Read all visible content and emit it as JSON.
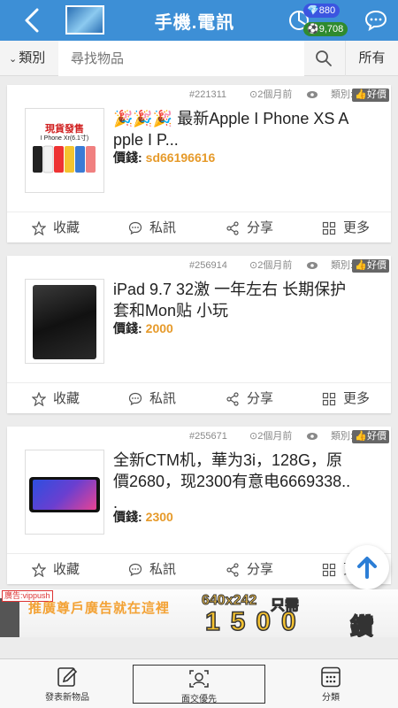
{
  "header": {
    "title": "手機.電訊",
    "diamonds": "880",
    "coins": "9,708"
  },
  "search": {
    "category_label": "類別",
    "placeholder": "尋找物品",
    "all_label": "所有"
  },
  "listings": [
    {
      "post_id": "#221311",
      "time": "2個月前",
      "category_label": "類別:",
      "tag": "好價",
      "title_line1": "🎉🎉🎉 最新Apple I Phone XS A",
      "title_line2": "pple I P...",
      "price_label": "價錢:",
      "price": "sd66196616",
      "image_text1": "現貨發售",
      "image_text2": "I Phone Xr(6.1寸)"
    },
    {
      "post_id": "#256914",
      "time": "2個月前",
      "category_label": "類別:",
      "tag": "好價",
      "title_line1": "iPad 9.7 32激 一年左右 长期保护",
      "title_line2": "套和Mon贴 小玩",
      "price_label": "價錢:",
      "price": "2000"
    },
    {
      "post_id": "#255671",
      "time": "2個月前",
      "category_label": "類別:",
      "tag": "好價",
      "title_line1": "全新CTM机，華为3i，128G，原",
      "title_line2": "價2680，现2300有意电6669338..",
      "title_line3": ".",
      "price_label": "價錢:",
      "price": "2300"
    }
  ],
  "actions": {
    "favorite": "收藏",
    "message": "私訊",
    "share": "分享",
    "more": "更多"
  },
  "ad": {
    "label": "廣告:vippush",
    "text": "推廣尊戶廣告就在這裡",
    "dimension": "640x242",
    "need": "只需",
    "amount": "1500",
    "unit": "鑽"
  },
  "bottom_nav": {
    "post": "發表新物品",
    "face": "面交優先",
    "category": "分類"
  },
  "colors": {
    "header_bg": "#3d8fd6",
    "price": "#e69a2a",
    "diamond_badge": "#3b55e0",
    "coin_badge": "#2f8a2f"
  }
}
